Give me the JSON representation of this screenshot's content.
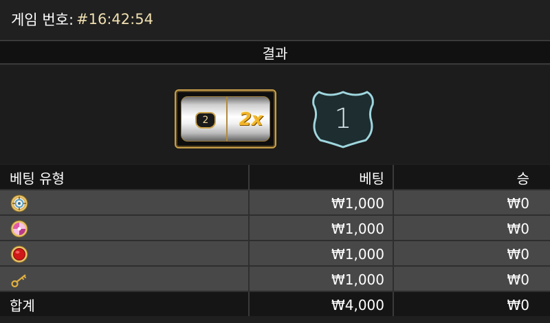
{
  "header": {
    "label": "게임 번호:",
    "game_id": "#16:42:54"
  },
  "result": {
    "title": "결과",
    "slot_badge": "2",
    "slot_multiplier": "2x",
    "outcome_number": "1"
  },
  "table": {
    "columns": [
      "베팅 유형",
      "베팅",
      "승"
    ],
    "rows": [
      {
        "icon": "target-coin-icon",
        "bet": "₩1,000",
        "win": "₩0"
      },
      {
        "icon": "candy-swirl-coin-icon",
        "bet": "₩1,000",
        "win": "₩0"
      },
      {
        "icon": "red-coin-icon",
        "bet": "₩1,000",
        "win": "₩0"
      },
      {
        "icon": "gold-key-icon",
        "bet": "₩1,000",
        "win": "₩0"
      }
    ],
    "total": {
      "label": "합계",
      "bet": "₩4,000",
      "win": "₩0"
    }
  },
  "colors": {
    "accent_gold": "#c9a04a",
    "game_id_text": "#f0dfb0",
    "shield_stroke": "#9fd6de",
    "row_dark": "#151515",
    "row_light": "#484848"
  }
}
